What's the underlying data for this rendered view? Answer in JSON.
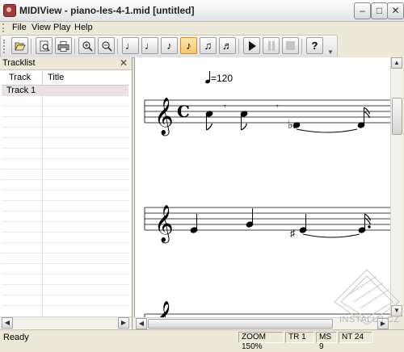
{
  "window": {
    "title": "MIDIView - piano-les-4-1.mid [untitled]"
  },
  "menu": [
    "File",
    "View",
    "Play",
    "Help"
  ],
  "toolbar": {
    "buttons": [
      {
        "name": "open",
        "icon": "folder-open-icon"
      },
      {
        "name": "print-preview",
        "icon": "print-preview-icon"
      },
      {
        "name": "print",
        "icon": "printer-icon"
      },
      {
        "name": "zoom-in",
        "icon": "zoom-in-icon"
      },
      {
        "name": "zoom-out",
        "icon": "zoom-out-icon"
      },
      {
        "name": "note-whole",
        "icon": "whole-note-icon"
      },
      {
        "name": "note-half",
        "icon": "half-note-icon"
      },
      {
        "name": "note-quarter",
        "icon": "quarter-note-icon"
      },
      {
        "name": "note-eighth",
        "icon": "eighth-note-icon",
        "active": true
      },
      {
        "name": "note-sixteenth",
        "icon": "sixteenth-note-icon"
      },
      {
        "name": "note-thirtysecond",
        "icon": "thirtysecond-note-icon"
      },
      {
        "name": "play",
        "icon": "play-icon"
      },
      {
        "name": "pause",
        "icon": "pause-icon",
        "disabled": true
      },
      {
        "name": "stop",
        "icon": "stop-icon",
        "disabled": true
      },
      {
        "name": "help",
        "icon": "help-icon"
      }
    ]
  },
  "tracklist": {
    "title": "Tracklist",
    "columns": [
      "Track",
      "Title"
    ],
    "rows": [
      {
        "track": "Track 1",
        "title": ""
      }
    ]
  },
  "score": {
    "tempo": "=120"
  },
  "status": {
    "ready": "Ready",
    "zoom": "ZOOM 150%",
    "track": "TR 1",
    "ms": "MS 9",
    "nt": "NT 24"
  },
  "watermark": "INSTALUJ.CZ"
}
